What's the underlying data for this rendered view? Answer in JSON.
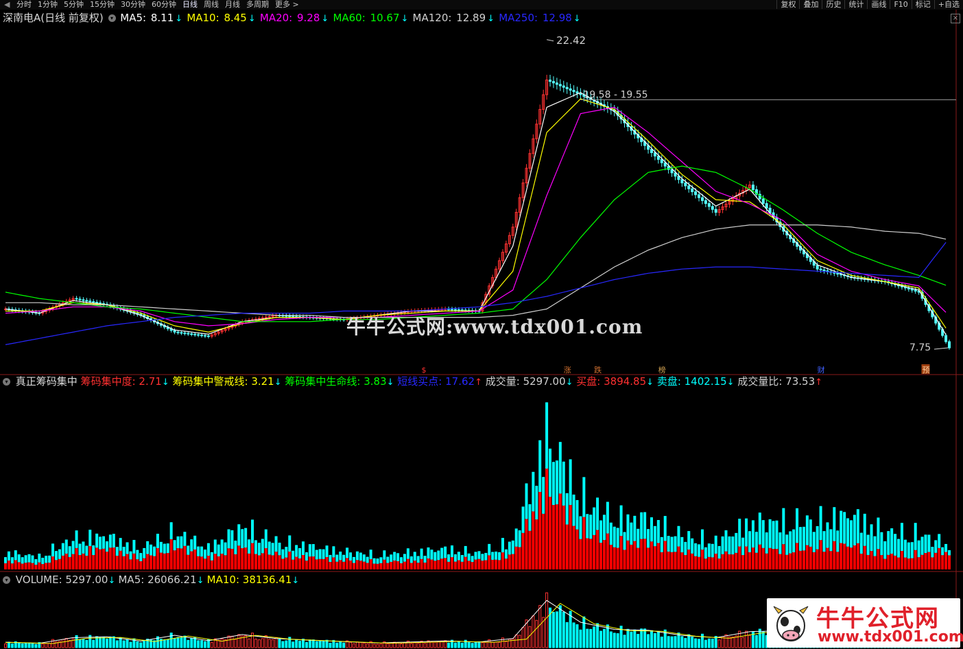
{
  "toolbar": {
    "tabs": [
      "分时",
      "1分钟",
      "5分钟",
      "15分钟",
      "30分钟",
      "60分钟",
      "日线",
      "周线",
      "月线",
      "多周期",
      "更多 >"
    ],
    "active_tab": "日线",
    "right_buttons": [
      "复权",
      "叠加",
      "历史",
      "统计",
      "画线",
      "F10",
      "标记",
      "+自选"
    ]
  },
  "price_panel": {
    "title": "深南电A(日线 前复权)",
    "ma": [
      {
        "label": "MA5:",
        "value": "8.11",
        "dir": "↓",
        "color": "#ffffff"
      },
      {
        "label": "MA10:",
        "value": "8.45",
        "dir": "↓",
        "color": "#ffff00"
      },
      {
        "label": "MA20:",
        "value": "9.28",
        "dir": "↓",
        "color": "#ff00ff"
      },
      {
        "label": "MA60:",
        "value": "10.67",
        "dir": "↓",
        "color": "#00ff00"
      },
      {
        "label": "MA120:",
        "value": "12.89",
        "dir": "↓",
        "color": "#d0d0d0"
      },
      {
        "label": "MA250:",
        "value": "12.98",
        "dir": "↓",
        "color": "#2828ff"
      }
    ],
    "annotations": {
      "high": "22.42",
      "range": "19.58 - 19.55",
      "low": "7.75"
    },
    "markers": [
      "$",
      "涨",
      "跌",
      "榜",
      "财",
      "预"
    ],
    "close_icon": "×"
  },
  "watermark": "牛牛公式网:www.tdx001.com",
  "indicator_panel": {
    "name": "真正筹码集中",
    "items": [
      {
        "label": "筹码集中度:",
        "value": "2.71",
        "dir": "↓",
        "label_color": "#ff3030",
        "value_color": "#ff3030"
      },
      {
        "label": "筹码集中警戒线:",
        "value": "3.21",
        "dir": "↓",
        "label_color": "#ffff00",
        "value_color": "#ffff00"
      },
      {
        "label": "筹码集中生命线:",
        "value": "3.83",
        "dir": "↓",
        "label_color": "#00ff00",
        "value_color": "#00ff00"
      },
      {
        "label": "短线买点:",
        "value": "17.62",
        "dir": "↑",
        "label_color": "#2828ff",
        "value_color": "#2828ff"
      },
      {
        "label": "成交量:",
        "value": "5297.00",
        "dir": "↓",
        "label_color": "#d0d0d0",
        "value_color": "#d0d0d0"
      },
      {
        "label": "买盘:",
        "value": "3894.85",
        "dir": "↓",
        "label_color": "#ff3030",
        "value_color": "#ff3030"
      },
      {
        "label": "卖盘:",
        "value": "1402.15",
        "dir": "↓",
        "label_color": "#00ffff",
        "value_color": "#00ffff"
      },
      {
        "label": "成交量比:",
        "value": "73.53",
        "dir": "↑",
        "label_color": "#d0d0d0",
        "value_color": "#d0d0d0"
      }
    ]
  },
  "volume_panel": {
    "items": [
      {
        "label": "VOLUME:",
        "value": "5297.00",
        "dir": "↓",
        "color": "#d0d0d0"
      },
      {
        "label": "MA5:",
        "value": "26066.21",
        "dir": "↓",
        "color": "#d0d0d0"
      },
      {
        "label": "MA10:",
        "value": "38136.41",
        "dir": "↓",
        "color": "#ffff00"
      }
    ]
  },
  "logo": {
    "cn": "牛牛公式网",
    "url": "www.tdx001.com"
  },
  "chart_data": [
    {
      "type": "line",
      "title": "深南电A(日线 前复权)",
      "x": [
        0,
        10,
        20,
        30,
        40,
        50,
        60,
        70,
        80,
        90,
        100,
        110,
        120,
        130,
        140,
        150,
        160,
        170,
        180,
        190,
        200,
        210,
        220,
        230,
        240,
        250,
        260,
        270,
        279
      ],
      "ylim": [
        7,
        23
      ],
      "series": [
        {
          "name": "收盘价",
          "values": [
            9.6,
            9.4,
            10.1,
            9.8,
            9.3,
            8.5,
            8.3,
            9.0,
            9.3,
            9.2,
            9.1,
            9.3,
            9.5,
            9.6,
            9.5,
            13.5,
            20.5,
            19.8,
            19.0,
            17.2,
            15.6,
            14.2,
            15.5,
            13.3,
            11.5,
            11.1,
            10.9,
            10.4,
            7.75
          ]
        },
        {
          "name": "MA5",
          "values": [
            9.6,
            9.4,
            10.0,
            9.8,
            9.3,
            8.6,
            8.4,
            9.0,
            9.2,
            9.2,
            9.1,
            9.3,
            9.5,
            9.5,
            9.5,
            12.6,
            19.2,
            19.9,
            19.0,
            17.4,
            15.8,
            14.5,
            15.3,
            13.4,
            11.7,
            11.1,
            10.9,
            10.5,
            8.11
          ]
        },
        {
          "name": "MA10",
          "values": [
            9.5,
            9.5,
            9.9,
            9.8,
            9.4,
            8.8,
            8.5,
            8.9,
            9.2,
            9.2,
            9.1,
            9.3,
            9.4,
            9.5,
            9.5,
            11.4,
            18.0,
            19.6,
            19.1,
            17.6,
            16.0,
            14.8,
            14.7,
            13.6,
            11.9,
            11.2,
            10.9,
            10.6,
            8.45
          ]
        },
        {
          "name": "MA20",
          "values": [
            9.4,
            9.5,
            9.7,
            9.7,
            9.5,
            9.0,
            8.8,
            8.9,
            9.1,
            9.2,
            9.2,
            9.2,
            9.3,
            9.4,
            9.5,
            10.5,
            15.0,
            18.9,
            19.2,
            18.0,
            16.6,
            15.2,
            14.6,
            13.8,
            12.2,
            11.4,
            11.0,
            10.7,
            9.28
          ]
        },
        {
          "name": "MA60",
          "values": [
            10.4,
            10.1,
            9.9,
            9.7,
            9.6,
            9.4,
            9.2,
            9.0,
            9.0,
            9.0,
            9.1,
            9.1,
            9.2,
            9.3,
            9.4,
            9.6,
            11.0,
            13.0,
            14.8,
            16.1,
            16.4,
            16.1,
            15.3,
            14.3,
            13.2,
            12.3,
            11.7,
            11.2,
            10.67
          ]
        },
        {
          "name": "MA120",
          "values": [
            9.9,
            9.9,
            9.8,
            9.8,
            9.7,
            9.6,
            9.5,
            9.4,
            9.3,
            9.3,
            9.2,
            9.2,
            9.2,
            9.2,
            9.2,
            9.3,
            9.6,
            10.6,
            11.6,
            12.4,
            13.0,
            13.4,
            13.6,
            13.6,
            13.6,
            13.5,
            13.3,
            13.2,
            12.89
          ]
        },
        {
          "name": "MA250",
          "values": [
            7.9,
            8.2,
            8.5,
            8.8,
            9.0,
            9.2,
            9.3,
            9.4,
            9.4,
            9.4,
            9.5,
            9.5,
            9.5,
            9.6,
            9.7,
            9.9,
            10.2,
            10.6,
            11.0,
            11.3,
            11.5,
            11.6,
            11.6,
            11.5,
            11.4,
            11.3,
            11.2,
            11.1,
            12.98
          ]
        }
      ]
    },
    {
      "type": "bar",
      "title": "真正筹码集中",
      "x": [
        0,
        10,
        20,
        30,
        40,
        50,
        60,
        70,
        80,
        90,
        100,
        110,
        120,
        130,
        140,
        150,
        160,
        170,
        180,
        190,
        200,
        210,
        220,
        230,
        240,
        250,
        260,
        270,
        279
      ],
      "series": [
        {
          "name": "买盘",
          "values": [
            1800,
            1200,
            3500,
            4500,
            2200,
            5200,
            2400,
            4800,
            3200,
            2500,
            2000,
            1600,
            1800,
            2200,
            2000,
            3200,
            17500,
            8800,
            5600,
            5800,
            3800,
            2800,
            4500,
            4200,
            4800,
            5200,
            3000,
            3200,
            3894.85
          ]
        },
        {
          "name": "卖盘",
          "values": [
            1800,
            1500,
            3000,
            2600,
            2200,
            2800,
            2200,
            4300,
            2800,
            2400,
            1800,
            1500,
            1800,
            2200,
            1500,
            2800,
            11500,
            6600,
            5200,
            5000,
            3400,
            3200,
            5500,
            6000,
            5500,
            6500,
            5000,
            4400,
            1402.15
          ]
        }
      ]
    },
    {
      "type": "bar",
      "title": "VOLUME",
      "x": [
        0,
        10,
        20,
        30,
        40,
        50,
        60,
        70,
        80,
        90,
        100,
        110,
        120,
        130,
        140,
        150,
        160,
        170,
        180,
        190,
        200,
        210,
        220,
        230,
        240,
        250,
        260,
        270,
        279
      ],
      "series": [
        {
          "name": "VOLUME",
          "values": [
            3000,
            2400,
            5500,
            6000,
            3600,
            6800,
            3800,
            7200,
            5000,
            4100,
            3300,
            2600,
            3100,
            3700,
            3100,
            5000,
            26000,
            14000,
            10000,
            9600,
            6700,
            5500,
            8800,
            9300,
            9300,
            10500,
            7100,
            6700,
            5297.0
          ]
        }
      ]
    }
  ]
}
